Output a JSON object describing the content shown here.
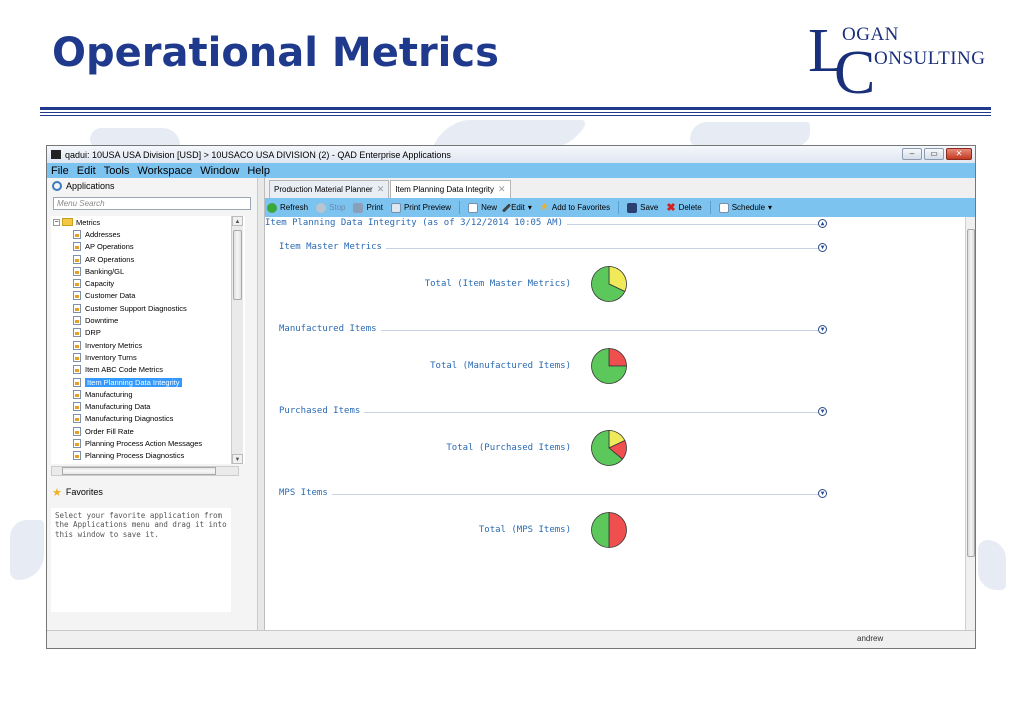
{
  "slide": {
    "title": "Operational Metrics",
    "logo": {
      "big1": "L",
      "small1": "OGAN",
      "big2": "C",
      "small2": "ONSULTING"
    }
  },
  "window": {
    "title": "qadui: 10USA USA Division [USD] > 10USACO USA DIVISION (2) - QAD Enterprise Applications",
    "controls": {
      "minimize": "–",
      "maximize": "▭",
      "close": "✕"
    },
    "menu": [
      "File",
      "Edit",
      "Tools",
      "Workspace",
      "Window",
      "Help"
    ]
  },
  "left": {
    "apps_title": "Applications",
    "search_placeholder": "Menu Search",
    "tree_root": "Metrics",
    "tree_items": [
      "Addresses",
      "AP Operations",
      "AR Operations",
      "Banking/GL",
      "Capacity",
      "Customer Data",
      "Customer Support Diagnostics",
      "Downtime",
      "DRP",
      "Inventory Metrics",
      "Inventory Turns",
      "Item ABC Code Metrics",
      "Item Planning Data Integrity",
      "Manufacturing",
      "Manufacturing Data",
      "Manufacturing Diagnostics",
      "Order Fill Rate",
      "Planning Process Action Messages",
      "Planning Process Diagnostics"
    ],
    "selected_item": "Item Planning Data Integrity",
    "favorites_title": "Favorites",
    "favorites_hint": "Select your favorite application from the Applications menu and drag it into this window to save it."
  },
  "tabs": [
    {
      "label": "Production Material Planner",
      "active": false
    },
    {
      "label": "Item Planning Data Integrity",
      "active": true
    }
  ],
  "toolbar": {
    "refresh": "Refresh",
    "stop": "Stop",
    "print": "Print",
    "print_preview": "Print Preview",
    "new": "New",
    "edit": "Edit",
    "add_favorites": "Add to Favorites",
    "save": "Save",
    "delete": "Delete",
    "schedule": "Schedule"
  },
  "report": {
    "title": "Item Planning Data Integrity (as of 3/12/2014 10:05 AM)",
    "sections": [
      {
        "heading": "Item Master Metrics",
        "total_label": "Total (Item Master Metrics)",
        "slices": {
          "green": 0.68,
          "yellow": 0.32,
          "red": 0
        }
      },
      {
        "heading": "Manufactured Items",
        "total_label": "Total (Manufactured Items)",
        "slices": {
          "green": 0.75,
          "yellow": 0,
          "red": 0.25
        }
      },
      {
        "heading": "Purchased Items",
        "total_label": "Total (Purchased Items)",
        "slices": {
          "green": 0.64,
          "yellow": 0.18,
          "red": 0.18
        }
      },
      {
        "heading": "MPS Items",
        "total_label": "Total (MPS Items)",
        "slices": {
          "green": 0.5,
          "yellow": 0,
          "red": 0.5
        }
      }
    ]
  },
  "colors": {
    "green": "#5cc85c",
    "yellow": "#f0ea5a",
    "red": "#ef4f4f",
    "accent": "#7cc3f0",
    "title": "#1f3a8c"
  },
  "status": {
    "user": "andrew"
  }
}
